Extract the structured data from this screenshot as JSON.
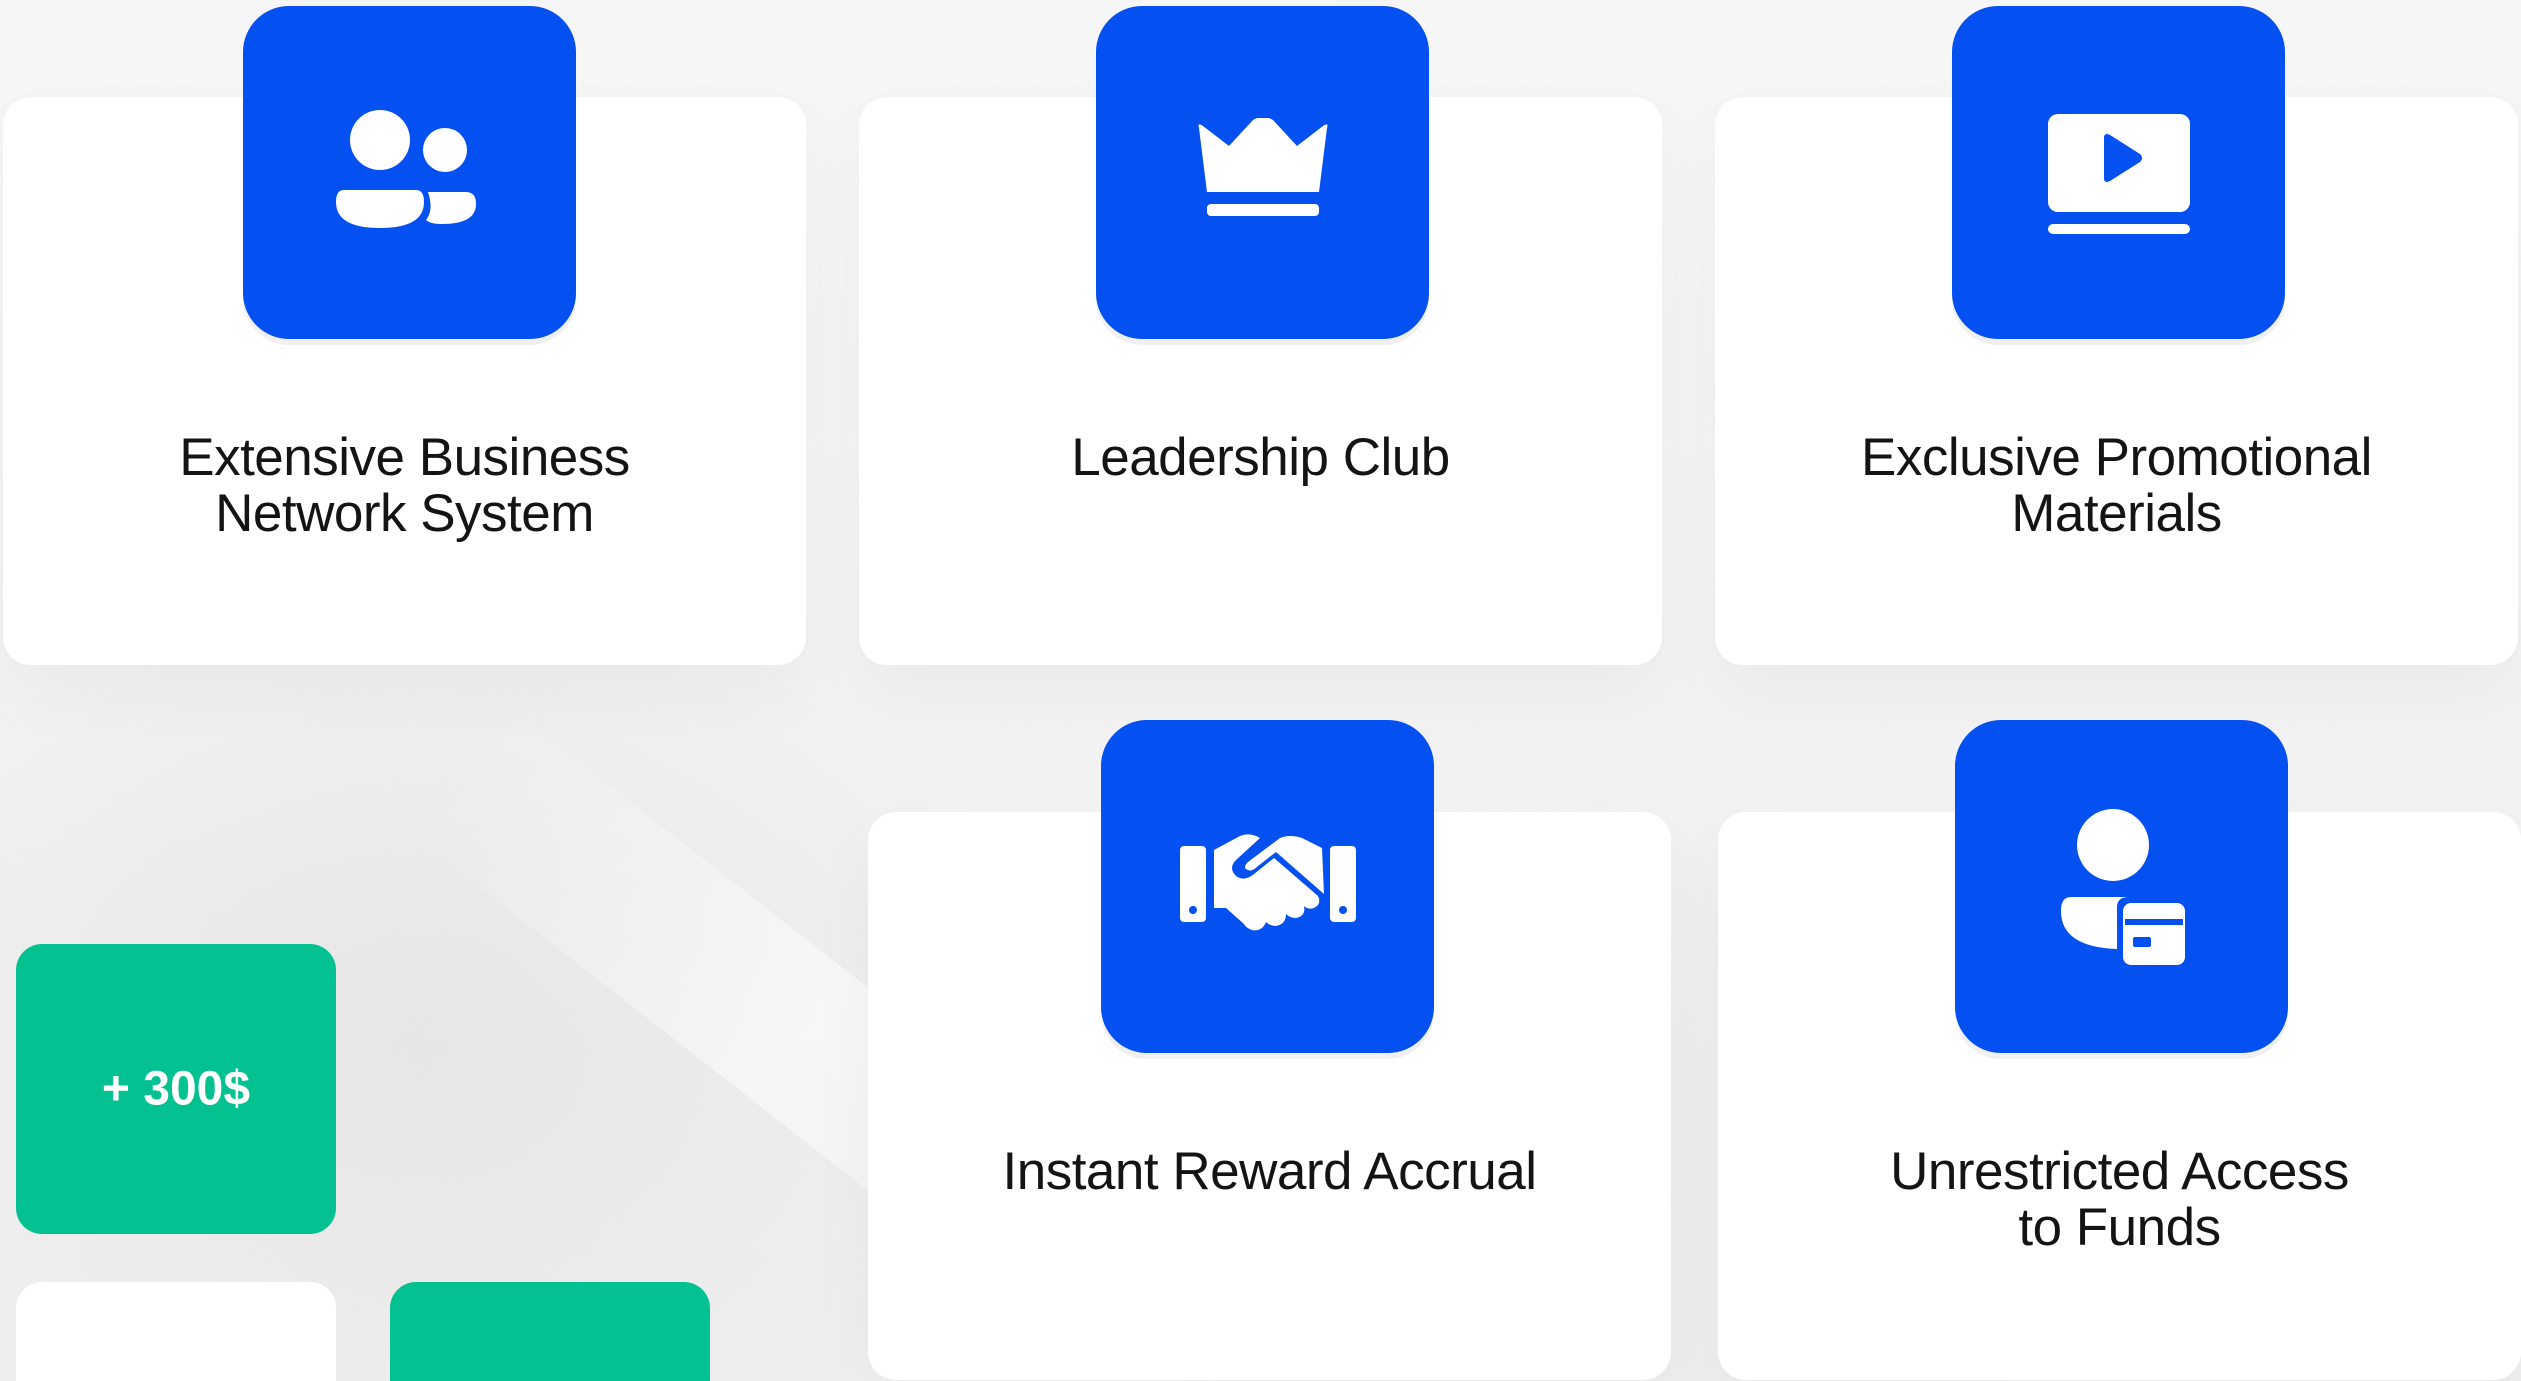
{
  "colors": {
    "accent": "#0550F0",
    "green": "#03C191",
    "card": "#FFFFFF",
    "text": "#141414"
  },
  "features": [
    {
      "icon": "users-icon",
      "line1": "Extensive Business",
      "line2": "Network System"
    },
    {
      "icon": "crown-icon",
      "line1": "Leadership Club",
      "line2": ""
    },
    {
      "icon": "video-icon",
      "line1": "Exclusive Promotional",
      "line2": "Materials"
    },
    {
      "icon": "handshake-icon",
      "line1": "Instant Reward Accrual",
      "line2": ""
    },
    {
      "icon": "user-card-icon",
      "line1": "Unrestricted Access",
      "line2": "to Funds"
    }
  ],
  "bonus": {
    "label": "+ 300$"
  }
}
